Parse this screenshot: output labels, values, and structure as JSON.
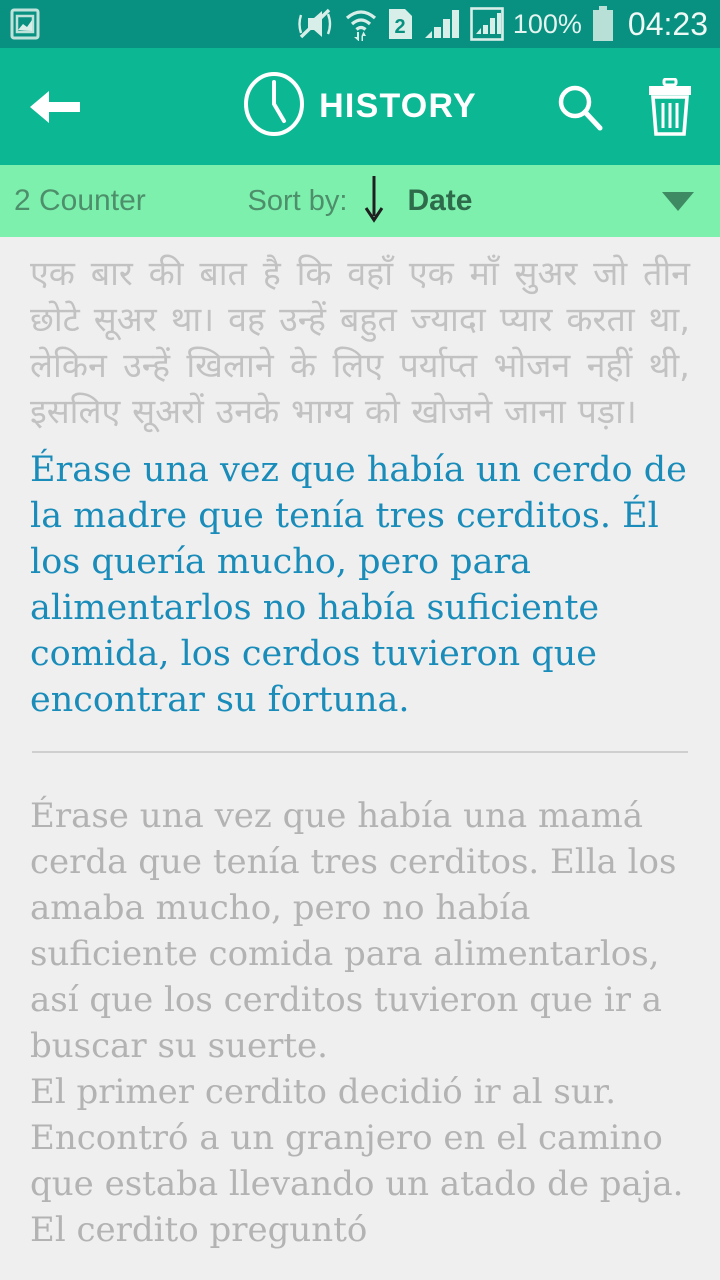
{
  "status_bar": {
    "background": "#089080",
    "icons": [
      "screenshot-image-icon",
      "vibrate-mute-icon",
      "wifi-icon",
      "sim-2-icon",
      "signal-bars-icon",
      "signal-bars-2-icon"
    ],
    "sim_label": "2",
    "battery_percent": "100%",
    "time": "04:23"
  },
  "header": {
    "background": "#0cb894",
    "back_icon": "arrow-left-icon",
    "clock_icon": "clock-icon",
    "title": "HISTORY",
    "search_icon": "search-icon",
    "delete_icon": "trash-icon"
  },
  "sort_bar": {
    "background": "#7df0ad",
    "counter": "2 Counter",
    "sort_label": "Sort by:",
    "direction_icon": "arrow-down-icon",
    "sort_value": "Date",
    "dropdown_icon": "caret-down-icon"
  },
  "content": {
    "background": "#efefef",
    "source_text": "एक बार की बात है कि वहाँ एक माँ सुअर जो तीन छोटे सूअर था। वह उन्हें बहुत ज्यादा प्यार करता था, लेकिन उन्हें खिलाने के लिए पर्याप्त भोजन नहीं थी, इसलिए सूअरों उनके भाग्य को खोजने जाना पड़ा।",
    "source_color": "#c2c2c2",
    "translated_text": "Érase una vez que había un cerdo de la madre que tenía tres cerditos. Él los quería mucho, pero para alimentarlos no había suficiente comida, los cerdos tuvieron que encontrar su fortuna.",
    "translated_color": "#1a8cba",
    "detail_paragraphs": [
      "Érase una vez que había una mamá cerda que tenía tres cerditos. Ella los amaba mucho, pero no había suficiente comida para alimentarlos, así que los cerditos tuvieron que ir a buscar su suerte.",
      "El primer cerdito decidió ir al sur. Encontró a un granjero en el camino que estaba llevando un atado de paja. El cerdito preguntó"
    ],
    "detail_color": "#b3b3b3"
  }
}
